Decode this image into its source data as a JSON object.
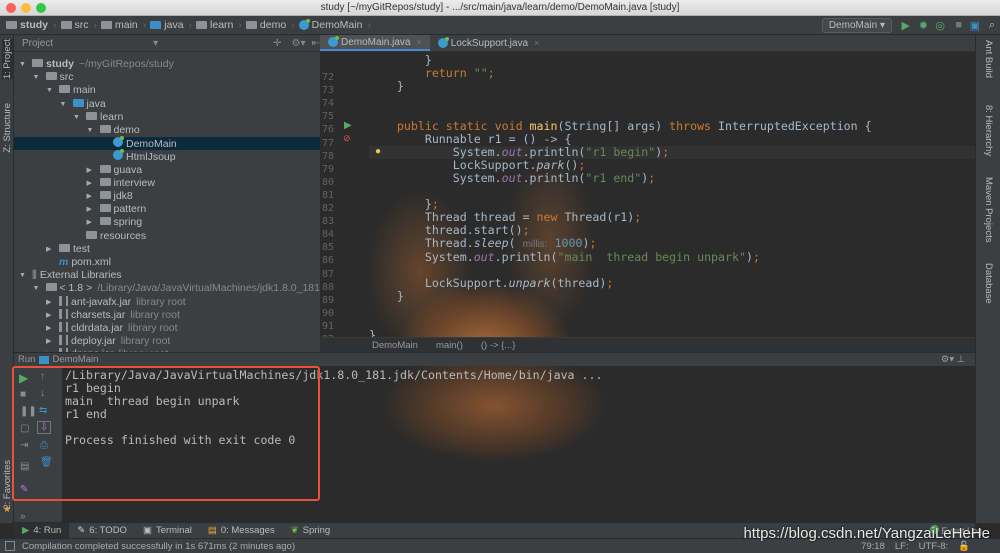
{
  "window": {
    "title": "study [~/myGitRepos/study] - .../src/main/java/learn/demo/DemoMain.java [study]"
  },
  "navbar": {
    "crumbs": [
      "study",
      "src",
      "main",
      "java",
      "learn",
      "demo",
      "DemoMain"
    ],
    "run_config": "DemoMain"
  },
  "left_strip": {
    "tabs": [
      "1: Project",
      "Z: Structure",
      "2: Favorites"
    ]
  },
  "right_strip": {
    "tabs": [
      "Ant Build",
      "8: Hierarchy",
      "Maven Projects",
      "Database"
    ]
  },
  "project": {
    "header": "Project",
    "tree": [
      {
        "label": "study",
        "sub": "~/myGitRepos/study",
        "level": 0,
        "arrow": "open",
        "icon": "module",
        "bold": true
      },
      {
        "label": "src",
        "level": 1,
        "arrow": "open",
        "icon": "folder"
      },
      {
        "label": "main",
        "level": 2,
        "arrow": "open",
        "icon": "folder"
      },
      {
        "label": "java",
        "level": 3,
        "arrow": "open",
        "icon": "folder-blue"
      },
      {
        "label": "learn",
        "level": 4,
        "arrow": "open",
        "icon": "package"
      },
      {
        "label": "demo",
        "level": 5,
        "arrow": "open",
        "icon": "package"
      },
      {
        "label": "DemoMain",
        "level": 6,
        "arrow": "none",
        "icon": "class",
        "selected": true
      },
      {
        "label": "HtmlJsoup",
        "level": 6,
        "arrow": "none",
        "icon": "class"
      },
      {
        "label": "guava",
        "level": 5,
        "arrow": "closed",
        "icon": "package"
      },
      {
        "label": "interview",
        "level": 5,
        "arrow": "closed",
        "icon": "package"
      },
      {
        "label": "jdk8",
        "level": 5,
        "arrow": "closed",
        "icon": "package"
      },
      {
        "label": "pattern",
        "level": 5,
        "arrow": "closed",
        "icon": "package"
      },
      {
        "label": "spring",
        "level": 5,
        "arrow": "closed",
        "icon": "package"
      },
      {
        "label": "resources",
        "level": 4,
        "arrow": "none",
        "icon": "folder"
      },
      {
        "label": "test",
        "level": 2,
        "arrow": "closed",
        "icon": "folder"
      },
      {
        "label": "pom.xml",
        "level": 2,
        "arrow": "none",
        "icon": "maven"
      },
      {
        "label": "External Libraries",
        "level": 0,
        "arrow": "open",
        "icon": "libraries"
      },
      {
        "label": "< 1.8 >",
        "sub": "/Library/Java/JavaVirtualMachines/jdk1.8.0_181.jdk/Co",
        "level": 1,
        "arrow": "open",
        "icon": "folder"
      },
      {
        "label": "ant-javafx.jar",
        "sub": "library root",
        "level": 2,
        "arrow": "closed",
        "icon": "jar"
      },
      {
        "label": "charsets.jar",
        "sub": "library root",
        "level": 2,
        "arrow": "closed",
        "icon": "jar"
      },
      {
        "label": "cldrdata.jar",
        "sub": "library root",
        "level": 2,
        "arrow": "closed",
        "icon": "jar"
      },
      {
        "label": "deploy.jar",
        "sub": "library root",
        "level": 2,
        "arrow": "closed",
        "icon": "jar"
      },
      {
        "label": "dnsns.jar",
        "sub": "library root",
        "level": 2,
        "arrow": "closed",
        "icon": "jar"
      }
    ]
  },
  "editor": {
    "tabs": [
      {
        "label": "DemoMain.java",
        "active": true
      },
      {
        "label": "LockSupport.java",
        "active": false
      }
    ],
    "current_line": 79,
    "lines": [
      {
        "n": "72",
        "seg": [
          [
            "        }",
            ""
          ]
        ]
      },
      {
        "n": "73",
        "seg": [
          [
            "        ",
            ""
          ],
          [
            "return ",
            "k"
          ],
          [
            "\"\"",
            "s"
          ],
          [
            ";",
            "k"
          ]
        ]
      },
      {
        "n": "74",
        "seg": [
          [
            "    }",
            ""
          ]
        ]
      },
      {
        "n": "75",
        "seg": []
      },
      {
        "n": "76",
        "seg": []
      },
      {
        "n": "77",
        "seg": [
          [
            "    ",
            ""
          ],
          [
            "public static void ",
            "k"
          ],
          [
            "main",
            "f"
          ],
          [
            "(String[] args) ",
            ""
          ],
          [
            "throws ",
            "k"
          ],
          [
            "InterruptedException {",
            ""
          ]
        ]
      },
      {
        "n": "78",
        "seg": [
          [
            "        Runnable r1 = () -> {",
            ""
          ]
        ]
      },
      {
        "n": "79",
        "seg": [
          [
            "            System.",
            ""
          ],
          [
            "out",
            "st"
          ],
          [
            ".println(",
            ""
          ],
          [
            "\"r1 begin\"",
            "s"
          ],
          [
            ")",
            ""
          ],
          [
            ";",
            "k"
          ]
        ]
      },
      {
        "n": "80",
        "seg": [
          [
            "            LockSupport.",
            ""
          ],
          [
            "park",
            "it"
          ],
          [
            "()",
            ""
          ],
          [
            ";",
            "k"
          ]
        ]
      },
      {
        "n": "81",
        "seg": [
          [
            "            System.",
            ""
          ],
          [
            "out",
            "st"
          ],
          [
            ".println(",
            ""
          ],
          [
            "\"r1 end\"",
            "s"
          ],
          [
            ")",
            ""
          ],
          [
            ";",
            "k"
          ]
        ]
      },
      {
        "n": "82",
        "seg": []
      },
      {
        "n": "83",
        "seg": [
          [
            "        }",
            ""
          ],
          [
            ";",
            "k"
          ]
        ]
      },
      {
        "n": "84",
        "seg": [
          [
            "        Thread thread = ",
            ""
          ],
          [
            "new ",
            "k"
          ],
          [
            "Thread(r1)",
            ""
          ],
          [
            ";",
            "k"
          ]
        ]
      },
      {
        "n": "85",
        "seg": [
          [
            "        thread.start()",
            ""
          ],
          [
            ";",
            "k"
          ]
        ]
      },
      {
        "n": "86",
        "seg": [
          [
            "        Thread.",
            ""
          ],
          [
            "sleep",
            "it"
          ],
          [
            "( ",
            ""
          ],
          [
            "millis:",
            "h"
          ],
          [
            " ",
            ""
          ],
          [
            "1000",
            "n"
          ],
          [
            ")",
            ""
          ],
          [
            ";",
            "k"
          ]
        ]
      },
      {
        "n": "87",
        "seg": [
          [
            "        System.",
            ""
          ],
          [
            "out",
            "st"
          ],
          [
            ".println(",
            ""
          ],
          [
            "\"main  thread begin unpark\"",
            "s"
          ],
          [
            ")",
            ""
          ],
          [
            ";",
            "k"
          ]
        ]
      },
      {
        "n": "88",
        "seg": []
      },
      {
        "n": "89",
        "seg": [
          [
            "        LockSupport.",
            ""
          ],
          [
            "unpark",
            "it"
          ],
          [
            "(thread)",
            ""
          ],
          [
            ";",
            "k"
          ]
        ]
      },
      {
        "n": "90",
        "seg": [
          [
            "    }",
            ""
          ]
        ]
      },
      {
        "n": "91",
        "seg": []
      },
      {
        "n": "92",
        "seg": []
      },
      {
        "n": "93",
        "seg": [
          [
            "}",
            ""
          ]
        ]
      }
    ],
    "breadcrumbs": [
      "DemoMain",
      "main()",
      "() -> {...}"
    ]
  },
  "run": {
    "header_label": "Run",
    "config": "DemoMain",
    "output": [
      "/Library/Java/JavaVirtualMachines/jdk1.8.0_181.jdk/Contents/Home/bin/java ...",
      "r1 begin",
      "main  thread begin unpark",
      "r1 end",
      "",
      "Process finished with exit code 0"
    ]
  },
  "bottom_tabs": [
    {
      "label": "4: Run",
      "icon": "play-icon",
      "active": true
    },
    {
      "label": "6: TODO",
      "icon": "todo-icon"
    },
    {
      "label": "Terminal",
      "icon": "terminal-icon"
    },
    {
      "label": "0: Messages",
      "icon": "messages-icon"
    },
    {
      "label": "Spring",
      "icon": "spring-icon"
    }
  ],
  "status": {
    "message": "Compilation completed successfully in 1s 671ms (2 minutes ago)",
    "position": "79:18",
    "line_sep": "LF:",
    "encoding": "UTF-8:",
    "event_log": "Event Log"
  },
  "watermark": "https://blog.csdn.net/YangzaiLeHeHe",
  "colors": {
    "accent": "#4a88c7",
    "highlight_box": "#e8513a",
    "run_green": "#499c54"
  }
}
